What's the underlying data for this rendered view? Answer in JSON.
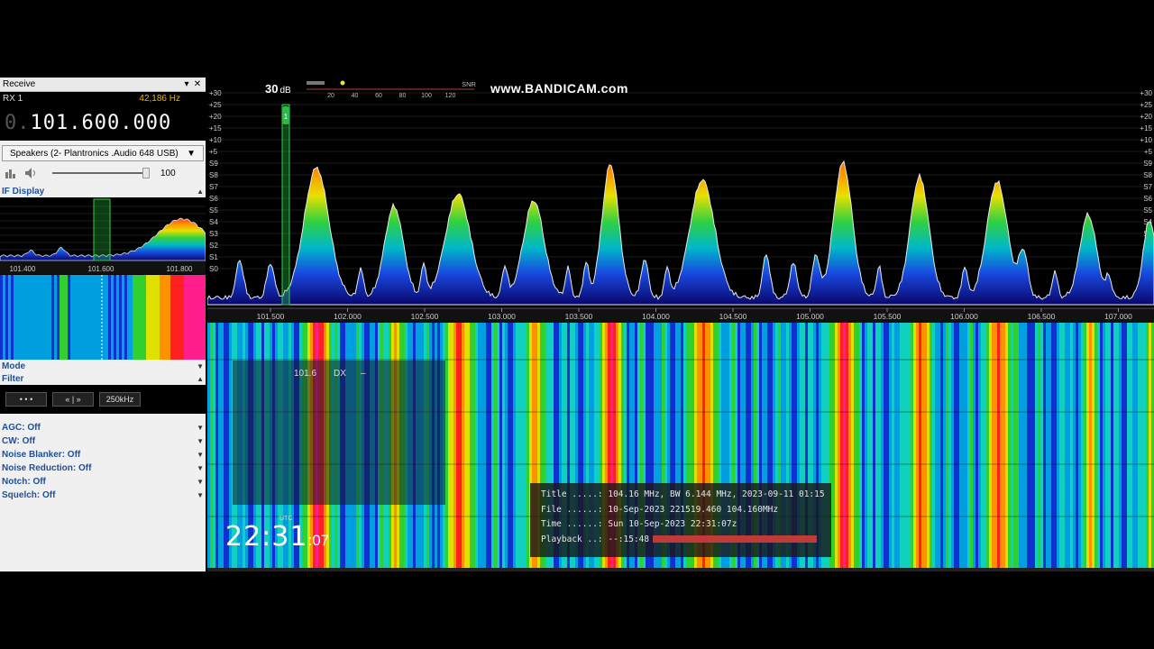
{
  "receive_panel": {
    "title": "Receive",
    "rx_label": "RX 1",
    "offset_hz": "42,186 Hz",
    "frequency_prefix": "0.",
    "frequency": "101.600.000",
    "output_device": "Speakers (2- Plantronics .Audio 648 USB)",
    "volume": "100",
    "volume_level": 1.0
  },
  "if_display": {
    "title": "IF Display",
    "tick_labels": [
      "101.400",
      "101.600",
      "101.800"
    ]
  },
  "mode": {
    "title": "Mode"
  },
  "filter": {
    "title": "Filter",
    "buttons": [
      "• • •",
      "« | »",
      "250kHz"
    ]
  },
  "options": [
    "AGC: Off",
    "CW: Off",
    "Noise Blanker: Off",
    "Noise Reduction: Off",
    "Notch: Off",
    "Squelch: Off"
  ],
  "spectrum": {
    "db_value": "30",
    "db_unit": "dB",
    "snr_label": "SNR",
    "snr_ticks": [
      "20",
      "40",
      "60",
      "80",
      "100",
      "120"
    ],
    "y_labels": [
      "+30",
      "+25",
      "+20",
      "+15",
      "+10",
      "+5",
      "S9",
      "S8",
      "S7",
      "S6",
      "S5",
      "S4",
      "S3",
      "S2",
      "S1",
      "S0"
    ],
    "x_labels": [
      "101.500",
      "102.000",
      "102.500",
      "103.000",
      "103.500",
      "104.000",
      "104.500",
      "105.000",
      "105.500",
      "106.000",
      "106.500",
      "107.000"
    ],
    "marker_label": "1",
    "watermark": "www.BANDICAM.com"
  },
  "rds": {
    "station": "101.6",
    "mode": "DX",
    "dash": "–"
  },
  "clock": {
    "utc_label": "UTC",
    "hours_minutes": "22:31",
    "seconds": ":07"
  },
  "file_info": {
    "title_line": "Title .....: 104.16 MHz, BW 6.144 MHz, 2023-09-11 01:15",
    "file_line": "File ......: 10-Sep-2023 221519.460 104.160MHz",
    "time_line": "Time ......: Sun 10-Sep-2023 22:31:07z",
    "playback_label": "Playback ..: --:15:48",
    "playback_progress": 1.0
  },
  "colors": {
    "panel_bg": "#f0f0f0",
    "section_header": "#1f4e9a",
    "offset_text": "#e8b400",
    "playback_bar": "#c03a3a"
  }
}
